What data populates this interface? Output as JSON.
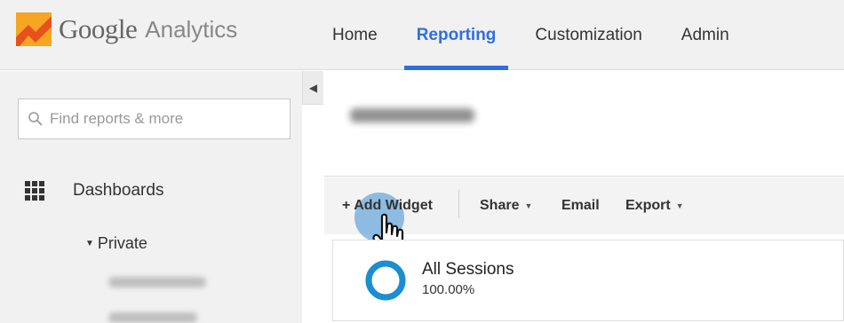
{
  "logo": {
    "brand": "Google",
    "product": "Analytics",
    "icon": "analytics-logo-icon"
  },
  "nav": {
    "items": [
      {
        "label": "Home",
        "active": false
      },
      {
        "label": "Reporting",
        "active": true
      },
      {
        "label": "Customization",
        "active": false
      },
      {
        "label": "Admin",
        "active": false
      }
    ]
  },
  "sidebar": {
    "search_placeholder": "Find reports & more",
    "dashboards_label": "Dashboards",
    "private_label": "Private"
  },
  "toolbar": {
    "add_widget": "+ Add Widget",
    "share": "Share",
    "email": "Email",
    "export": "Export"
  },
  "segment": {
    "name": "All Sessions",
    "percent": "100.00%",
    "share_value": 1.0
  },
  "colors": {
    "accent": "#2f6ee1",
    "donut": "#1a8ed1",
    "cursor_highlight": "#3a8cd2"
  }
}
